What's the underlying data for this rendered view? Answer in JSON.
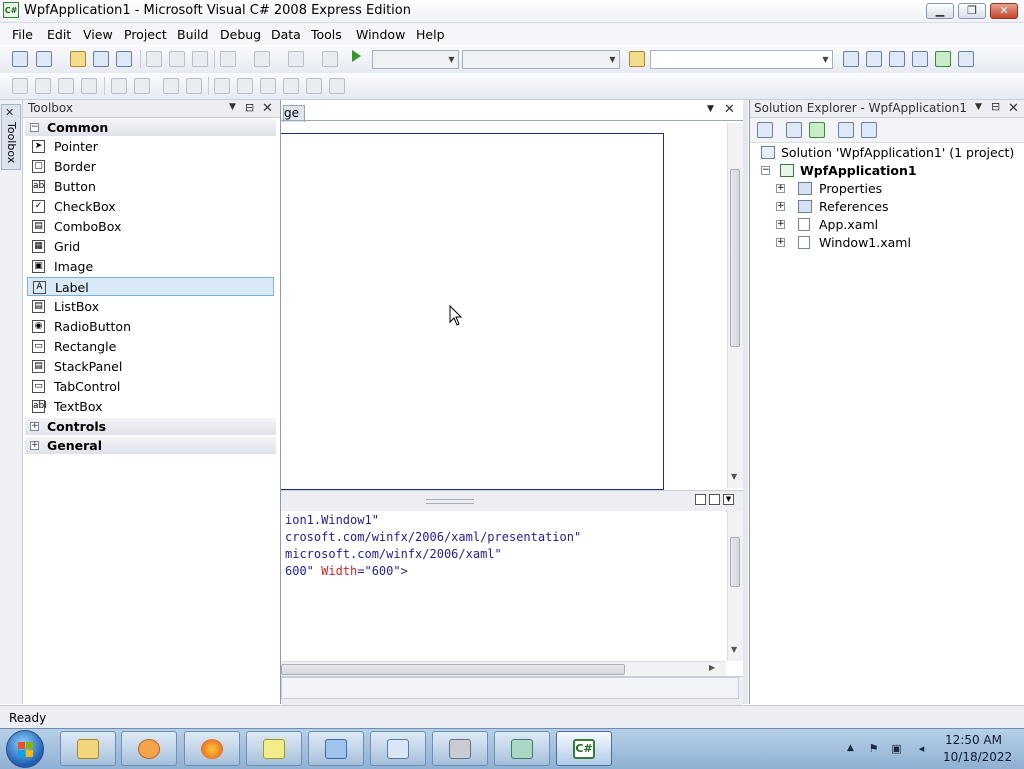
{
  "window": {
    "title": "WpfApplication1 - Microsoft Visual C# 2008 Express Edition",
    "icon_text": "C#",
    "minimize": "▁",
    "maximize": "❐",
    "close": "✕"
  },
  "menu": [
    "File",
    "Edit",
    "View",
    "Project",
    "Build",
    "Debug",
    "Data",
    "Tools",
    "Window",
    "Help"
  ],
  "vertical_tab": {
    "label": "Toolbox"
  },
  "toolbox": {
    "title": "Toolbox",
    "categories": {
      "common": "Common",
      "controls": "Controls",
      "general": "General"
    },
    "expanded_symbol": "−",
    "collapsed_symbol": "+",
    "items": [
      "Pointer",
      "Border",
      "Button",
      "CheckBox",
      "ComboBox",
      "Grid",
      "Image",
      "Label",
      "ListBox",
      "RadioButton",
      "Rectangle",
      "StackPanel",
      "TabControl",
      "TextBox"
    ],
    "item_glyphs": [
      "➤",
      "▢",
      "ab",
      "✓",
      "▤",
      "▦",
      "▣",
      "A",
      "▤",
      "◉",
      "▭",
      "▤",
      "▭",
      "abl"
    ],
    "selected_item": "Label"
  },
  "designer": {
    "tab_label": "ge",
    "xaml_lines": [
      {
        "text": "ion1.Window1\""
      },
      {
        "text": "crosoft.com/winfx/2006/xaml/presentation\""
      },
      {
        "text": "microsoft.com/winfx/2006/xaml\""
      },
      {
        "pre": "600\" ",
        "attr": "Width",
        "post": "=\"600\">"
      }
    ]
  },
  "solution_explorer": {
    "title": "Solution Explorer - WpfApplication1",
    "solution": "Solution 'WpfApplication1' (1 project)",
    "project": "WpfApplication1",
    "children": [
      "Properties",
      "References",
      "App.xaml",
      "Window1.xaml"
    ]
  },
  "status": {
    "text": "Ready"
  },
  "taskbar": {
    "time": "12:50 AM",
    "date": "10/18/2022",
    "active_app": "C#"
  },
  "colors": {
    "selection_bg": "#d8eaf7",
    "selection_border": "#7eb1d9",
    "designer_frame": "#1f2f86",
    "xaml_text": "#1f1fa6",
    "xaml_attr": "#dd2222"
  }
}
